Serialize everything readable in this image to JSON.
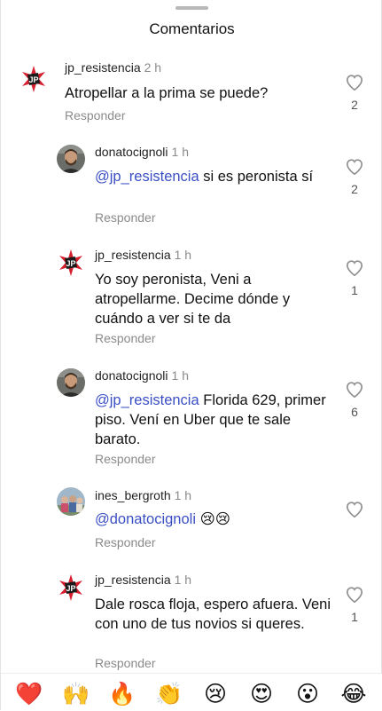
{
  "header": {
    "title": "Comentarios"
  },
  "comments": [
    {
      "user": "jp_resistencia",
      "time": "2 h",
      "text_mention": "",
      "text": "Atropellar a la prima se puede?",
      "reply": "Responder",
      "likes": "2"
    },
    {
      "user": "donatocignoli",
      "time": "1 h",
      "text_mention": "@jp_resistencia",
      "text": "si es peronista sí",
      "reply": "Responder",
      "likes": "2"
    },
    {
      "user": "jp_resistencia",
      "time": "1 h",
      "text_mention": "",
      "text": "Yo soy peronista, Veni a atropellarme. Decime dónde y cuándo a ver si te da",
      "reply": "Responder",
      "likes": "1"
    },
    {
      "user": "donatocignoli",
      "time": "1 h",
      "text_mention": "@jp_resistencia",
      "text": "Florida 629, primer piso. Vení en Uber que te sale barato.",
      "reply": "Responder",
      "likes": "6"
    },
    {
      "user": "ines_bergroth",
      "time": "1 h",
      "text_mention": "@donatocignoli",
      "text": "😢😢",
      "reply": "Responder",
      "likes": ""
    },
    {
      "user": "jp_resistencia",
      "time": "1 h",
      "text_mention": "",
      "text": "Dale rosca floja, espero afuera. Veni con uno de tus novios si queres.",
      "reply": "Responder",
      "likes": "1"
    }
  ],
  "emoji_bar": [
    "❤️",
    "🙌",
    "🔥",
    "👏",
    "😢",
    "😍",
    "😮",
    "😂"
  ],
  "colors": {
    "mention": "#3b4fc4",
    "heart": "#e0245e",
    "secondary_text": "#8a8a8a"
  },
  "icons": {
    "like": "heart-outline-icon",
    "avatar_jp": "jp-star-logo",
    "avatar_donato": "person-photo",
    "avatar_ines": "group-photo"
  }
}
